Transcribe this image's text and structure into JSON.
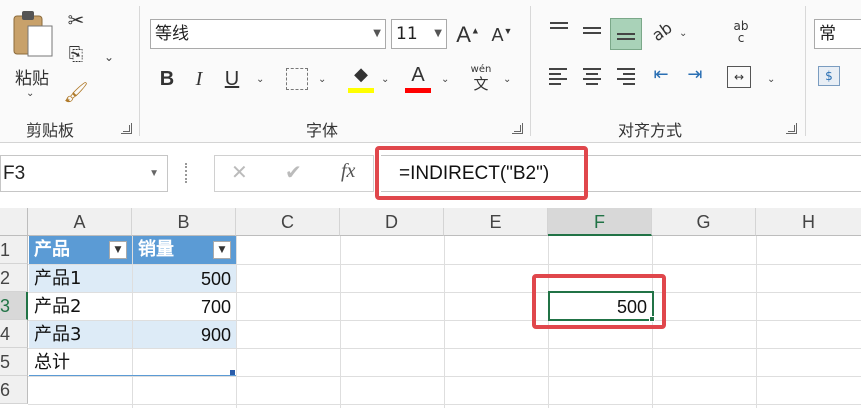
{
  "ribbon": {
    "clipboard": {
      "paste_label": "粘贴",
      "group_label": "剪贴板"
    },
    "font": {
      "font_name": "等线",
      "font_size": "11",
      "group_label": "字体",
      "bold": "B",
      "italic": "I",
      "underline": "U",
      "phonetic": "wén",
      "phonetic_char": "文",
      "grow": "A",
      "shrink": "A",
      "font_color_letter": "A",
      "fill_color": "#ffff00",
      "font_color": "#ff0000"
    },
    "alignment": {
      "group_label": "对齐方式",
      "wrap_text": "ab",
      "wrap_text2": "c"
    },
    "number": {
      "format_partial": "常"
    }
  },
  "formula_bar": {
    "name_box": "F3",
    "cancel_icon": "✕",
    "enter_icon": "✔",
    "fx_label": "fx",
    "formula": "=INDIRECT(\"B2\")"
  },
  "sheet": {
    "columns": [
      "A",
      "B",
      "C",
      "D",
      "E",
      "F",
      "G",
      "H"
    ],
    "rows": [
      "1",
      "2",
      "3",
      "4",
      "5",
      "6"
    ],
    "table": {
      "headers": [
        "产品",
        "销量"
      ],
      "rows": [
        [
          "产品1",
          "500"
        ],
        [
          "产品2",
          "700"
        ],
        [
          "产品3",
          "900"
        ],
        [
          "总计",
          ""
        ]
      ]
    },
    "selected_cell_value": "500"
  },
  "colors": {
    "accent_red": "#e0474c",
    "table_header": "#5b9bd5",
    "table_band": "#ddebf7",
    "selection": "#217346"
  }
}
